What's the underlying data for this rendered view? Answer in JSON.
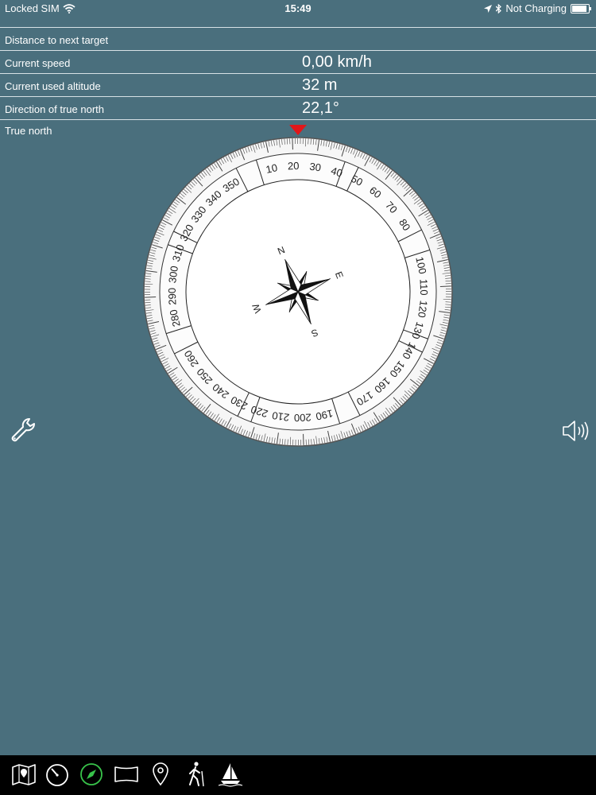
{
  "status_bar": {
    "carrier": "Locked SIM",
    "time": "15:49",
    "charging": "Not Charging",
    "battery_level": 0.95
  },
  "info": {
    "distance_label": "Distance to next target",
    "distance_value": "",
    "speed_label": "Current speed",
    "speed_value": "0,00 km/h",
    "altitude_label": "Current used altitude",
    "altitude_value": "32 m",
    "direction_label": "Direction of true north",
    "direction_value": "22,1°"
  },
  "compass": {
    "mode_label": "True north",
    "heading_deg": 22.1,
    "bezel_numbers": [
      "10",
      "20",
      "30",
      "40",
      "50",
      "60",
      "70",
      "80",
      "100",
      "110",
      "120",
      "130",
      "140",
      "150",
      "160",
      "170",
      "190",
      "200",
      "210",
      "220",
      "230",
      "240",
      "250",
      "260",
      "280",
      "290",
      "300",
      "310",
      "320",
      "330",
      "340",
      "350"
    ],
    "cardinals": {
      "n": "N",
      "e": "E",
      "s": "S",
      "w": "W"
    },
    "marker_color": "#e0171a"
  },
  "tabs": [
    {
      "name": "map",
      "icon": "map-icon",
      "active": false
    },
    {
      "name": "speed",
      "icon": "speedometer-icon",
      "active": false
    },
    {
      "name": "compass",
      "icon": "compass-icon",
      "active": true
    },
    {
      "name": "panorama",
      "icon": "panorama-icon",
      "active": false
    },
    {
      "name": "location",
      "icon": "location-pin-icon",
      "active": false
    },
    {
      "name": "hiking",
      "icon": "hiker-icon",
      "active": false
    },
    {
      "name": "sailing",
      "icon": "sailboat-icon",
      "active": false
    }
  ],
  "colors": {
    "background": "#4a6f7d",
    "active_tab": "#38c24a",
    "tab_bar": "#000000"
  }
}
